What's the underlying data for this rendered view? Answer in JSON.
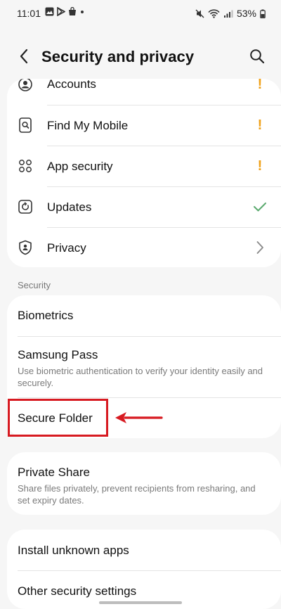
{
  "status_bar": {
    "time": "11:01",
    "battery": "53%",
    "left_icons": [
      "gallery-icon",
      "play-store-icon",
      "shopping-bag-icon",
      "dot-icon"
    ],
    "right_icons": [
      "mute-icon",
      "wifi-icon",
      "signal-icon",
      "battery-icon"
    ]
  },
  "header": {
    "title": "Security and privacy",
    "back_icon": "back-arrow-icon",
    "search_icon": "search-icon"
  },
  "top_card": {
    "items": [
      {
        "label": "Accounts",
        "icon": "account-icon",
        "trailing": "warning"
      },
      {
        "label": "Find My Mobile",
        "icon": "find-device-icon",
        "trailing": "warning"
      },
      {
        "label": "App security",
        "icon": "app-grid-icon",
        "trailing": "warning"
      },
      {
        "label": "Updates",
        "icon": "update-icon",
        "trailing": "check"
      },
      {
        "label": "Privacy",
        "icon": "shield-icon",
        "trailing": "chevron"
      }
    ],
    "warning_glyph": "!"
  },
  "security_section": {
    "label": "Security",
    "items": [
      {
        "label": "Biometrics"
      },
      {
        "label": "Samsung Pass",
        "description": "Use biometric authentication to verify your identity easily and securely."
      },
      {
        "label": "Secure Folder"
      }
    ]
  },
  "share_card": {
    "label": "Private Share",
    "description": "Share files privately, prevent recipients from resharing, and set expiry dates."
  },
  "bottom_card": {
    "items": [
      {
        "label": "Install unknown apps"
      },
      {
        "label": "Other security settings"
      }
    ]
  },
  "colors": {
    "background": "#f6f6f6",
    "card": "#ffffff",
    "warning": "#f0a21b",
    "check": "#5aa96e",
    "highlight": "#d71a21"
  }
}
